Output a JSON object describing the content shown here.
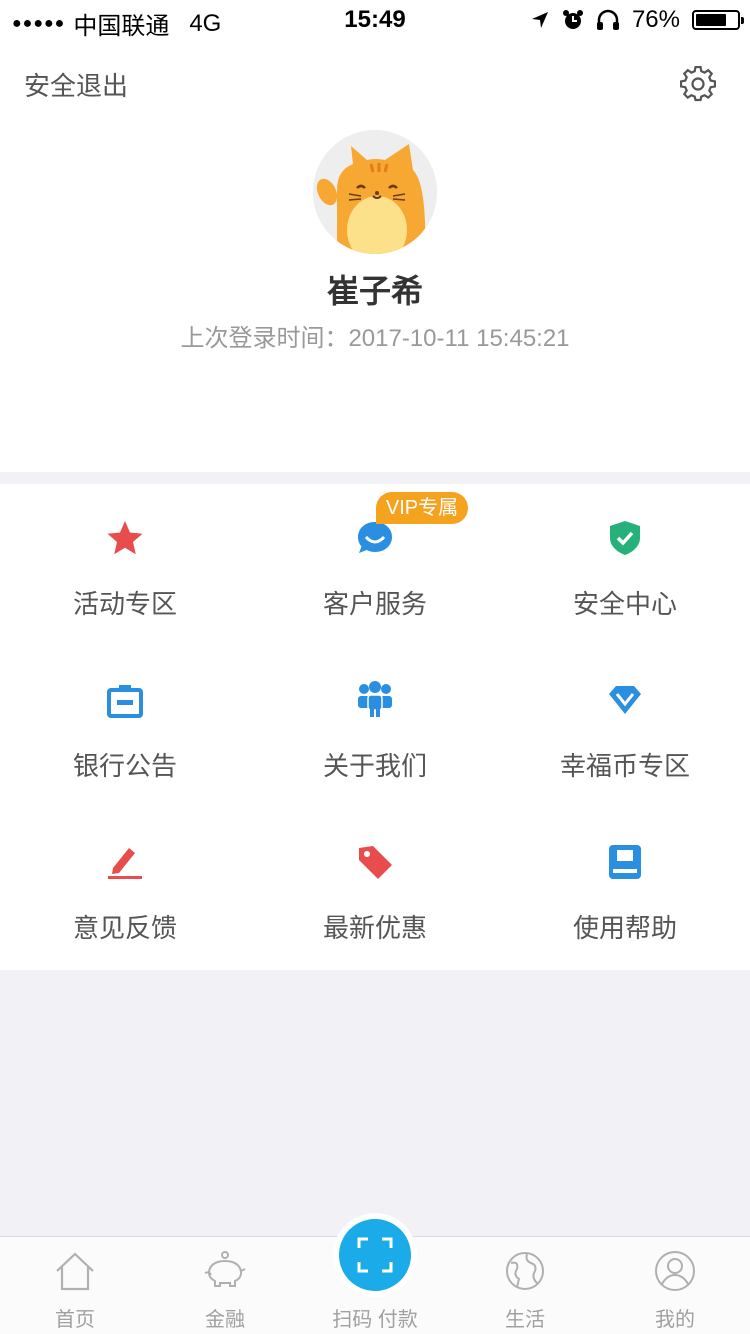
{
  "status_bar": {
    "signal": "●●●●●",
    "carrier": "中国联通",
    "network": "4G",
    "time": "15:49",
    "battery_text": "76%",
    "battery_level": 0.76
  },
  "profile": {
    "logout_label": "安全退出",
    "username": "崔子希",
    "last_login": "上次登录时间：2017-10-11 15:45:21"
  },
  "grid": {
    "vip_badge": "VIP专属",
    "items": [
      {
        "label": "活动专区",
        "icon": "star-icon",
        "color": "#e84c4c"
      },
      {
        "label": "客户服务",
        "icon": "chat-bubble-icon",
        "color": "#2a8fe0"
      },
      {
        "label": "安全中心",
        "icon": "shield-check-icon",
        "color": "#26b07a"
      },
      {
        "label": "银行公告",
        "icon": "announcement-box-icon",
        "color": "#2a8fe0"
      },
      {
        "label": "关于我们",
        "icon": "team-icon",
        "color": "#2a8fe0"
      },
      {
        "label": "幸福币专区",
        "icon": "diamond-icon",
        "color": "#2a8fe0"
      },
      {
        "label": "意见反馈",
        "icon": "pen-icon",
        "color": "#e84c4c"
      },
      {
        "label": "最新优惠",
        "icon": "tag-icon",
        "color": "#e84c4c"
      },
      {
        "label": "使用帮助",
        "icon": "book-icon",
        "color": "#2a8fe0"
      }
    ]
  },
  "tabbar": {
    "home": "首页",
    "finance": "金融",
    "scan": "扫码 付款",
    "life": "生活",
    "mine": "我的"
  }
}
